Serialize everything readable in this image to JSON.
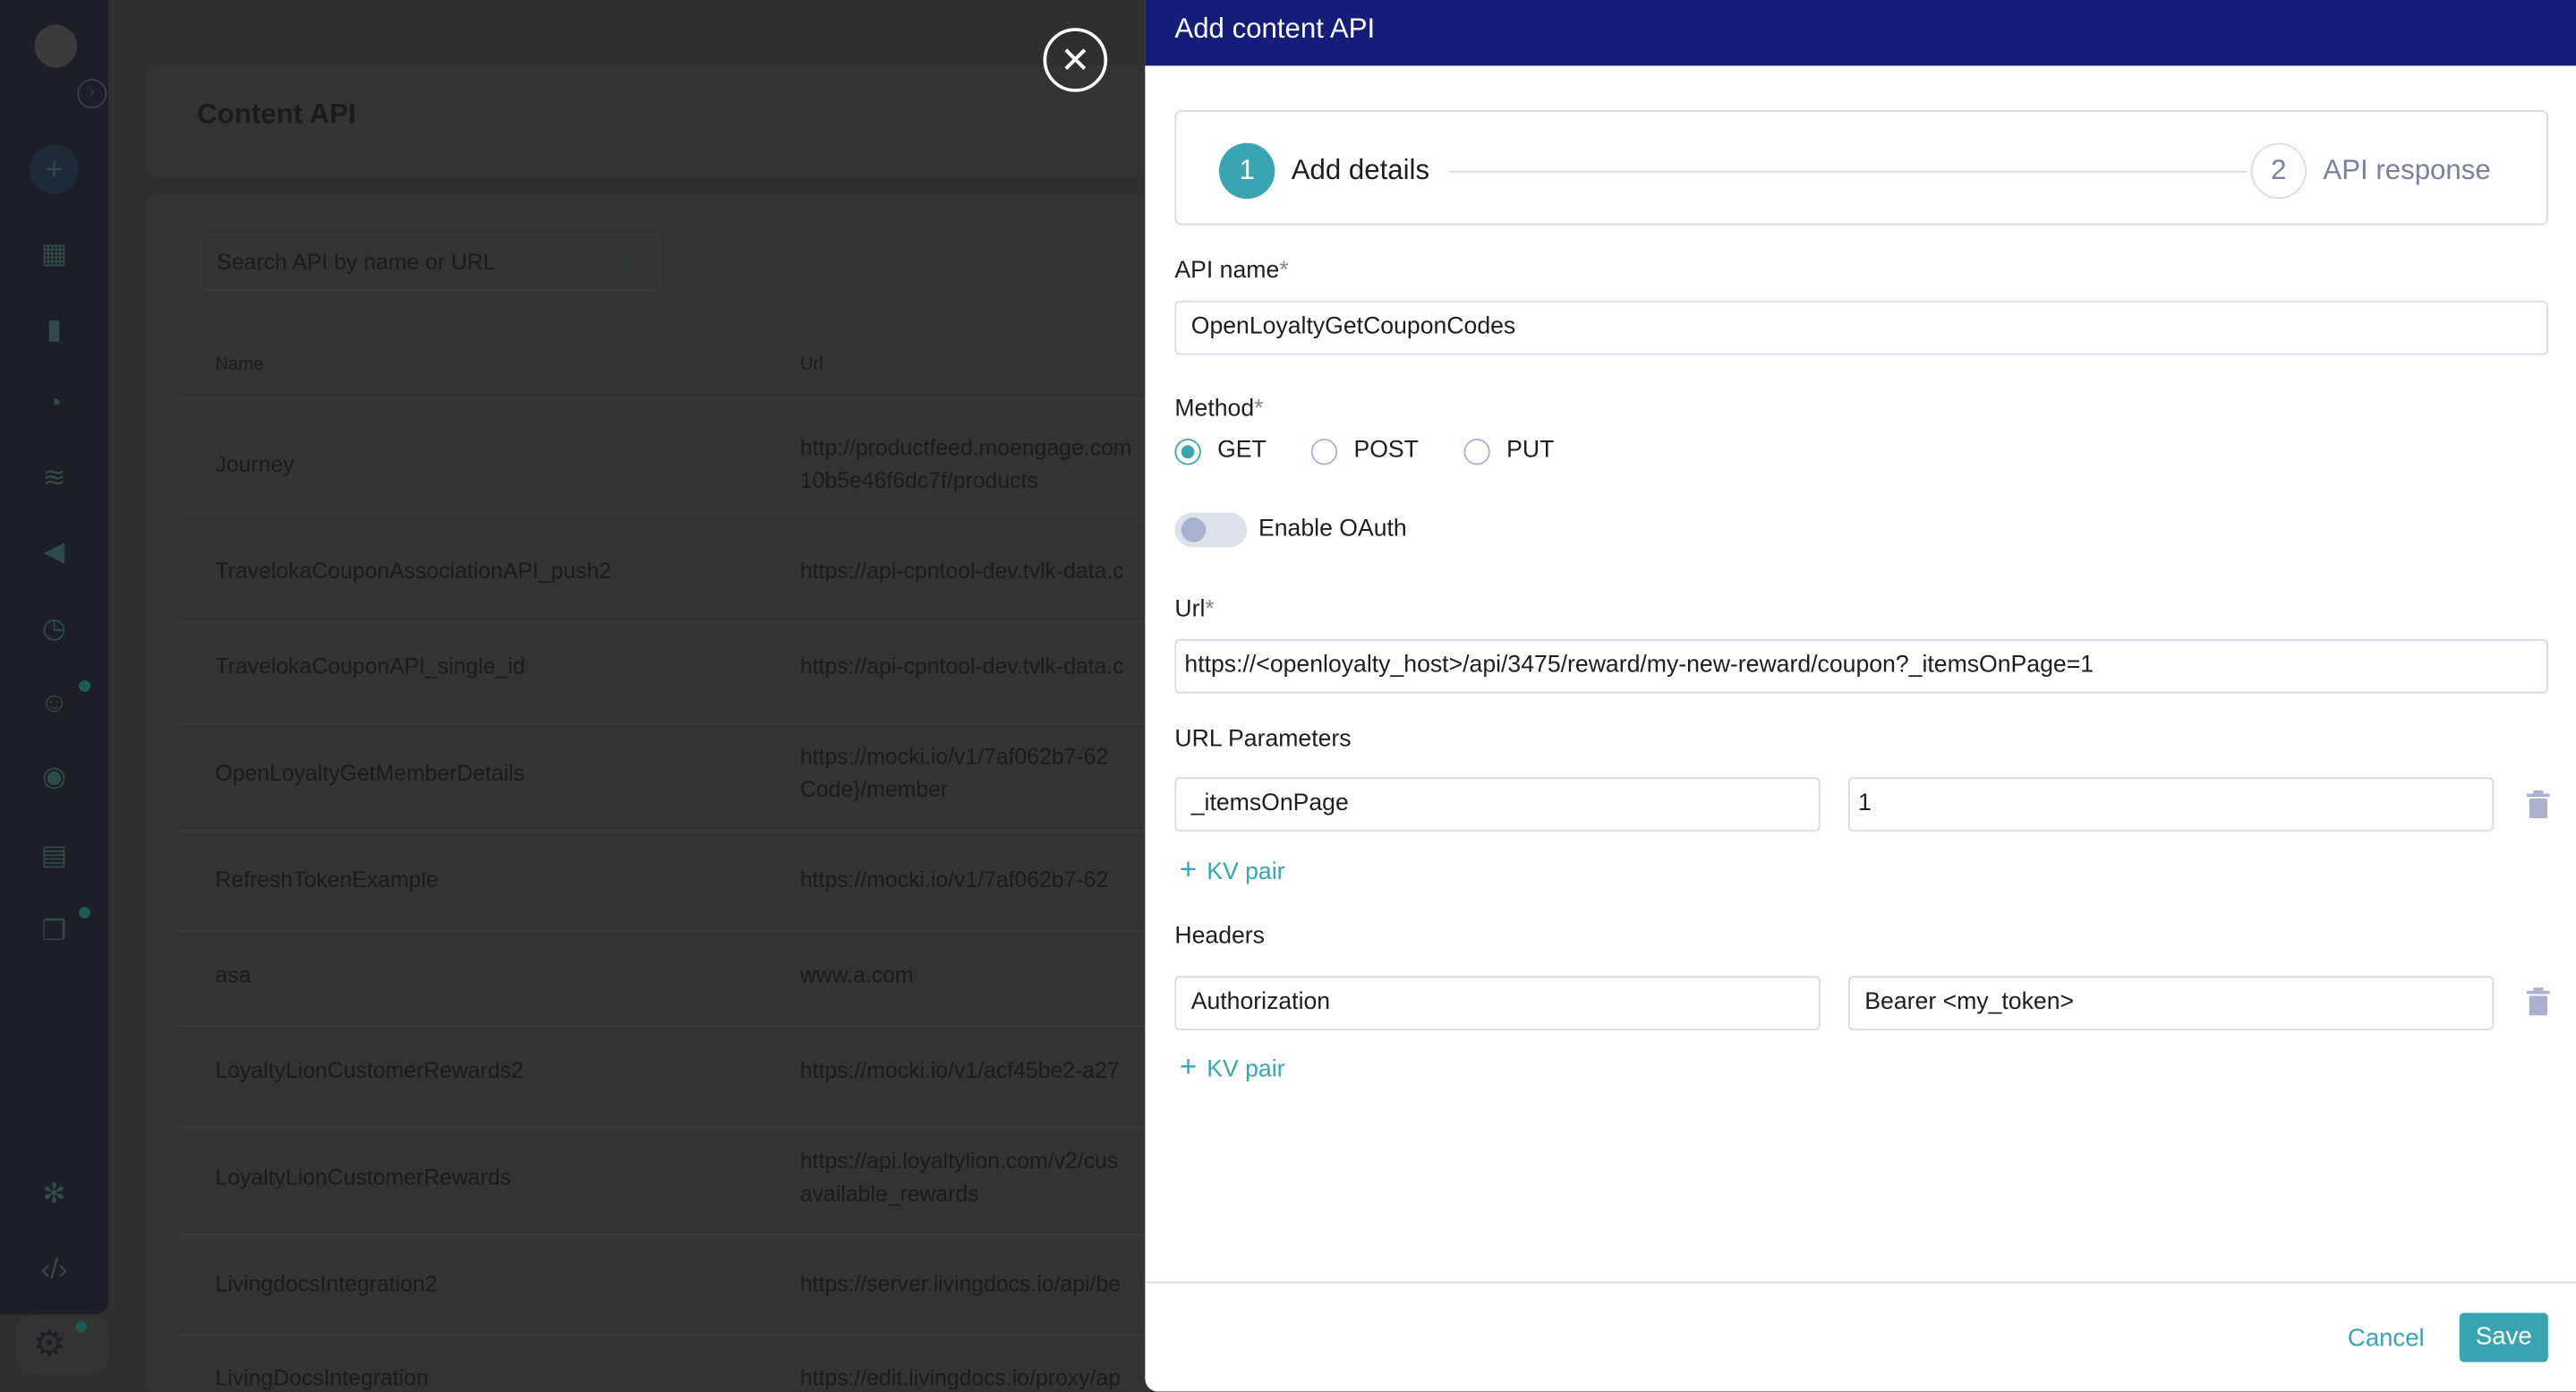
{
  "background_page": {
    "title": "Content API",
    "search_placeholder": "Search API by name or URL",
    "columns": [
      "Name",
      "Url"
    ],
    "rows": [
      {
        "name": "Journey",
        "url": [
          "http://productfeed.moengage.com",
          "10b5e46f6dc7f/products"
        ]
      },
      {
        "name": "TravelokaCouponAssociationAPI_push2",
        "url": [
          "https://api-cpntool-dev.tvlk-data.c"
        ]
      },
      {
        "name": "TravelokaCouponAPI_single_id",
        "url": [
          "https://api-cpntool-dev.tvlk-data.c"
        ]
      },
      {
        "name": "OpenLoyaltyGetMemberDetails",
        "url": [
          "https://mocki.io/v1/7af062b7-62",
          "Code}/member"
        ]
      },
      {
        "name": "RefreshTokenExample",
        "url": [
          "https://mocki.io/v1/7af062b7-62"
        ]
      },
      {
        "name": "asa",
        "url": [
          "www.a.com"
        ]
      },
      {
        "name": "LoyaltyLionCustomerRewards2",
        "url": [
          "https://mocki.io/v1/acf45be2-a27"
        ]
      },
      {
        "name": "LoyaltyLionCustomerRewards",
        "url": [
          "https://api.loyaltylion.com/v2/cus",
          "available_rewards"
        ]
      },
      {
        "name": "LivingdocsIntegration2",
        "url": [
          "https://server.livingdocs.io/api/be"
        ]
      },
      {
        "name": "LivingDocsIntegration",
        "url": [
          "https://edit.livingdocs.io/proxy/ap"
        ]
      }
    ]
  },
  "drawer": {
    "title": "Add content API",
    "steps": [
      {
        "number": "1",
        "label": "Add details",
        "active": true
      },
      {
        "number": "2",
        "label": "API response",
        "active": false
      }
    ],
    "api_name": {
      "label": "API name",
      "required": "*",
      "value": "OpenLoyaltyGetCouponCodes"
    },
    "method": {
      "label": "Method",
      "required": "*",
      "options": [
        "GET",
        "POST",
        "PUT"
      ],
      "selected": "GET"
    },
    "oauth": {
      "label": "Enable OAuth",
      "enabled": false
    },
    "url": {
      "label": "Url",
      "required": "*",
      "value": "https://<openloyalty_host>/api/3475/reward/my-new-reward/coupon?_itemsOnPage=1"
    },
    "url_params": {
      "label": "URL Parameters",
      "pairs": [
        {
          "key": "_itemsOnPage",
          "value": "1"
        }
      ],
      "add_label": "KV pair"
    },
    "headers": {
      "label": "Headers",
      "pairs": [
        {
          "key": "Authorization",
          "value": "Bearer <my_token>"
        }
      ],
      "add_label": "KV pair"
    },
    "cancel_label": "Cancel",
    "save_label": "Save"
  },
  "colors": {
    "header": "#161c7a",
    "accent": "#3aa5b2"
  }
}
